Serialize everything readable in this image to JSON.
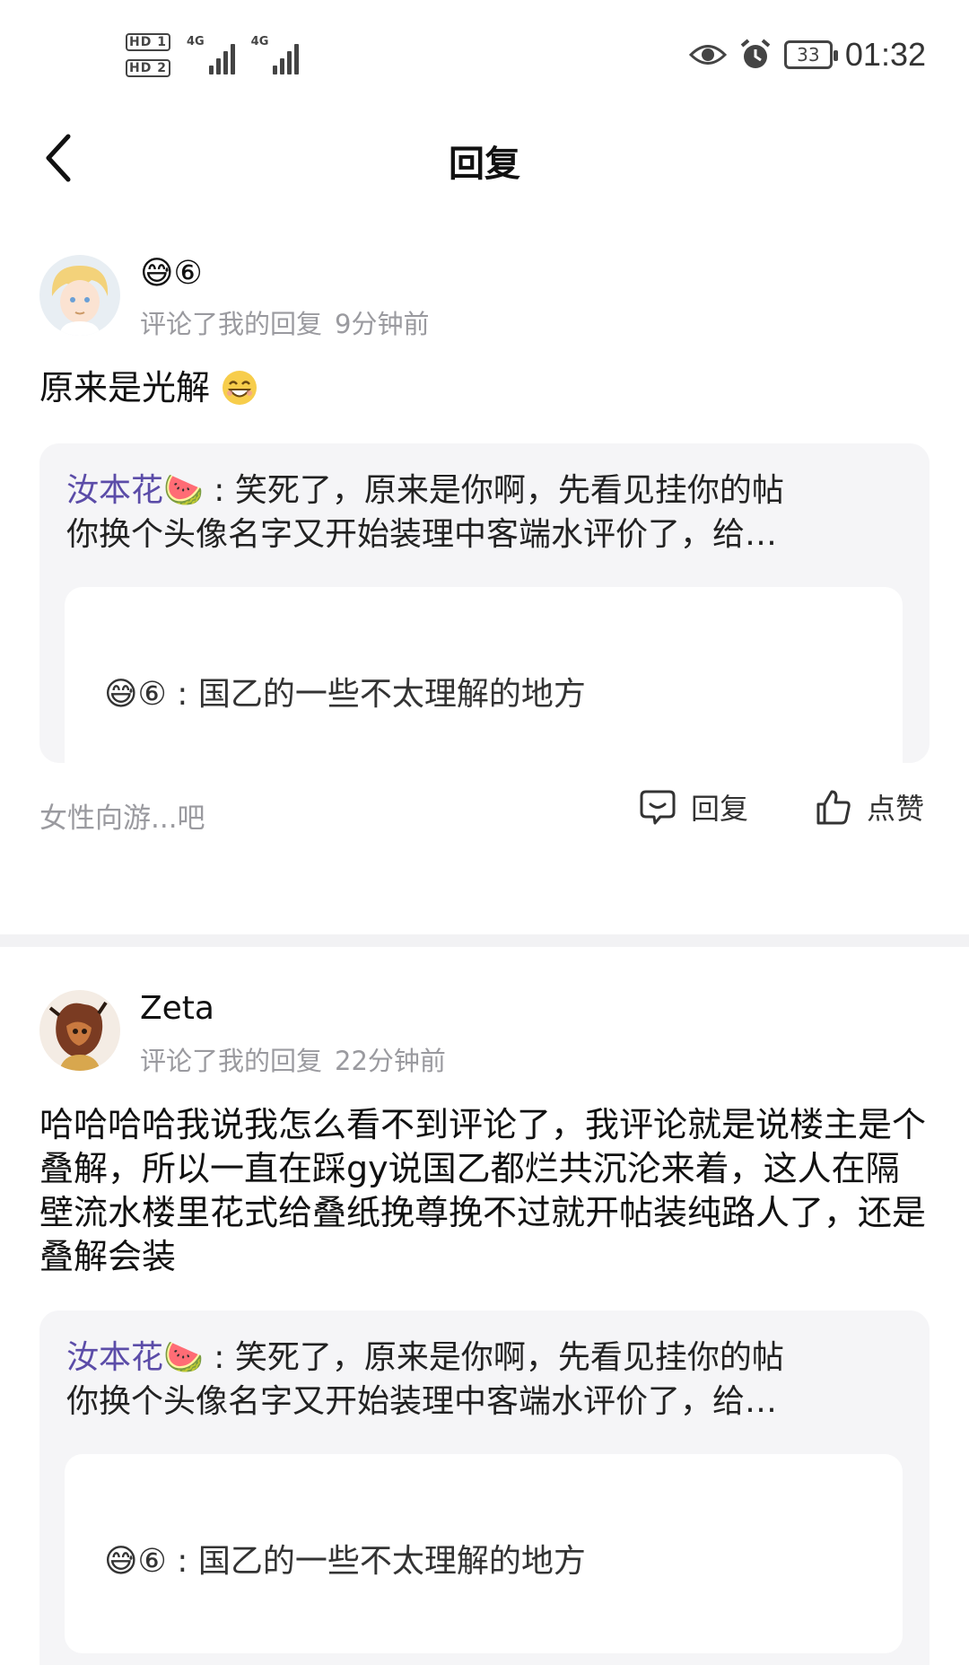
{
  "status_bar": {
    "sim1": "HD 1",
    "sim2": "HD 2",
    "net1": "4G",
    "net2": "4G",
    "battery": "33",
    "time": "01:32"
  },
  "header": {
    "title": "回复",
    "back_icon": "chevron-left-icon"
  },
  "notifications": [
    {
      "username": "😅⑥",
      "action": "评论了我的回复",
      "time": "9分钟前",
      "content": "原来是光解",
      "content_emoji": "grinning-face-icon",
      "quote": {
        "name": "汝本花🍉",
        "sep": ":",
        "text_line1": "笑死了，原来是你啊，先看见挂你的帖",
        "text_line2": "你换个头像名字又开始装理中客端水评价了，给…",
        "inner": "😅⑥ : 国乙的一些不太理解的地方"
      },
      "forum": "女性向游...吧",
      "reply_label": "回复",
      "like_label": "点赞"
    },
    {
      "username": "Zeta",
      "action": "评论了我的回复",
      "time": "22分钟前",
      "content": "哈哈哈哈我说我怎么看不到评论了，我评论就是说楼主是个叠解，所以一直在踩gy说国乙都烂共沉沦来着，这人在隔壁流水楼里花式给叠纸挽尊挽不过就开帖装纯路人了，还是叠解会装",
      "quote": {
        "name": "汝本花🍉",
        "sep": ":",
        "text_line1": "笑死了，原来是你啊，先看见挂你的帖",
        "text_line2": "你换个头像名字又开始装理中客端水评价了，给…",
        "inner": "😅⑥ : 国乙的一些不太理解的地方"
      }
    }
  ],
  "colors": {
    "quote_name": "#5b4ca8",
    "meta": "#9a9a9f",
    "quote_bg": "#f5f5f7"
  }
}
